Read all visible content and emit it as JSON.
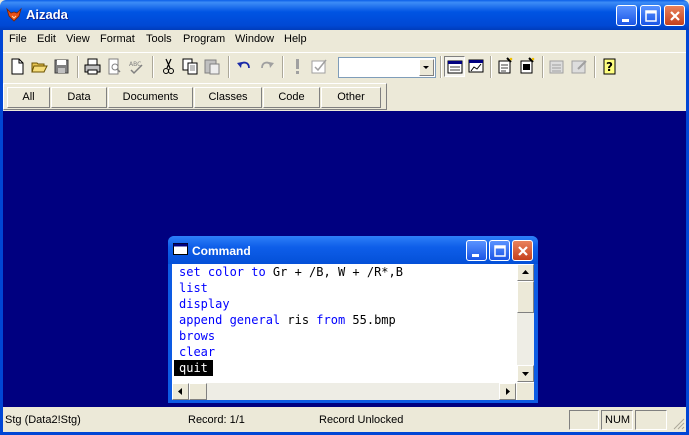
{
  "window": {
    "title": "Aizada"
  },
  "menu": [
    "File",
    "Edit",
    "View",
    "Format",
    "Tools",
    "Program",
    "Window",
    "Help"
  ],
  "toolbar": {
    "buttons": [
      "new-icon",
      "open-icon",
      "save-icon",
      "print-icon",
      "print-preview-icon",
      "spell-check-icon",
      "cut-icon",
      "copy-icon",
      "paste-icon",
      "undo-icon",
      "redo-icon",
      "run-icon",
      "modify-icon",
      "combo-box",
      "form-view-icon",
      "chart-icon",
      "report-wizard-icon",
      "label-wizard-icon",
      "form-builder-icon",
      "query-icon",
      "help-icon"
    ],
    "combo_value": ""
  },
  "tabs": [
    "All",
    "Data",
    "Documents",
    "Classes",
    "Code",
    "Other"
  ],
  "command_window": {
    "title": "Command",
    "lines": [
      {
        "parts": [
          {
            "t": "set color to",
            "kw": true
          },
          {
            "t": " Gr + /B, W + /R*,B",
            "kw": false
          }
        ]
      },
      {
        "parts": [
          {
            "t": "list",
            "kw": true
          }
        ]
      },
      {
        "parts": [
          {
            "t": "display",
            "kw": true
          }
        ]
      },
      {
        "parts": [
          {
            "t": "append general",
            "kw": true
          },
          {
            "t": " ris ",
            "kw": false
          },
          {
            "t": "from",
            "kw": true
          },
          {
            "t": " 55.bmp",
            "kw": false
          }
        ]
      },
      {
        "parts": [
          {
            "t": "brows",
            "kw": true
          }
        ]
      },
      {
        "parts": [
          {
            "t": "clear",
            "kw": true
          }
        ]
      },
      {
        "parts": [
          {
            "t": "quit",
            "kw": false
          }
        ],
        "selected": true
      }
    ]
  },
  "status": {
    "table": "Stg (Data2!Stg)",
    "record": "Record: 1/1",
    "lock": "Record Unlocked",
    "num": "NUM"
  },
  "colors": {
    "workspace": "#000080",
    "keyword": "#0000ff",
    "titlebar": "#0054e3"
  }
}
